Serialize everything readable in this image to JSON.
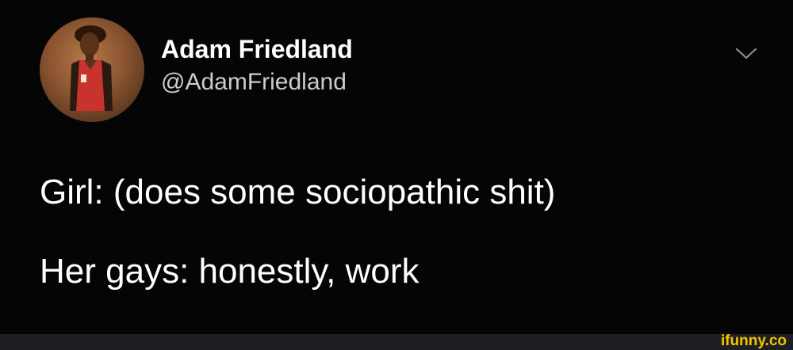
{
  "tweet": {
    "display_name": "Adam Friedland",
    "handle": "@AdamFriedland",
    "lines": [
      "Girl: (does some sociopathic shit)",
      "Her gays: honestly, work"
    ]
  },
  "icons": {
    "avatar": "profile-photo",
    "menu": "chevron-down-icon"
  },
  "watermark": {
    "text": "ifunny.co"
  },
  "colors": {
    "background": "#050505",
    "text": "#ffffff",
    "handle": "#c9ccd0",
    "watermark": "#f2c500"
  }
}
